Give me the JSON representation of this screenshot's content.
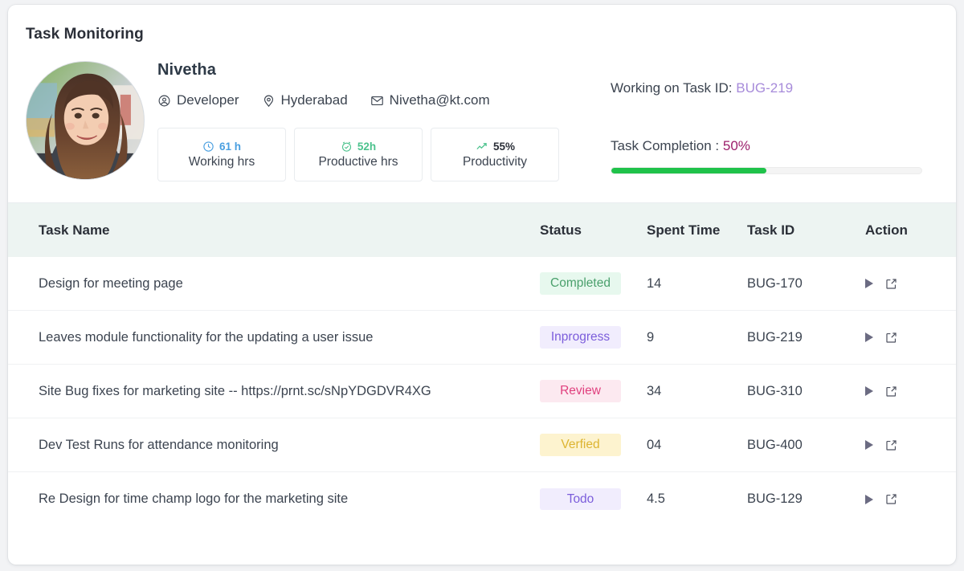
{
  "card": {
    "title": "Task Monitoring"
  },
  "profile": {
    "avatar_alt": "Nivetha profile photo",
    "name": "Nivetha",
    "meta": [
      {
        "icon": "user-circle-icon",
        "label": "Developer"
      },
      {
        "icon": "map-pin-icon",
        "label": "Hyderabad"
      },
      {
        "icon": "mail-icon",
        "label": "Nivetha@kt.com"
      }
    ],
    "stats": [
      {
        "icon": "clock-icon",
        "value": "61 h",
        "label": "Working hrs",
        "value_color": "#4a9fe0"
      },
      {
        "icon": "alarm-check-icon",
        "value": "52h",
        "label": "Productive hrs",
        "value_color": "#4cc28d"
      },
      {
        "icon": "trending-up-icon",
        "value": "55%",
        "label": "Productivity",
        "value_color": "#2b2f38"
      }
    ]
  },
  "task_summary": {
    "working_label": "Working on Task ID:",
    "working_task_id": "BUG-219",
    "working_task_id_color": "#a78bda",
    "completion_label": "Task Completion :",
    "completion_value": "50%",
    "completion_value_color": "#9c1f6b",
    "progress_percent": 50,
    "progress_color": "#1fc24a"
  },
  "table": {
    "columns": [
      {
        "key": "task_name",
        "label": "Task Name"
      },
      {
        "key": "status",
        "label": "Status"
      },
      {
        "key": "spent_time",
        "label": "Spent Time"
      },
      {
        "key": "task_id",
        "label": "Task ID"
      },
      {
        "key": "action",
        "label": "Action"
      }
    ],
    "rows": [
      {
        "task_name": "Design for meeting page",
        "status": "Completed",
        "status_class": "badge-completed",
        "spent_time": "14",
        "task_id": "BUG-170"
      },
      {
        "task_name": "Leaves module functionality for the updating a user issue",
        "status": "Inprogress",
        "status_class": "badge-inprogress",
        "spent_time": "9",
        "task_id": "BUG-219"
      },
      {
        "task_name": "Site Bug fixes for marketing site -- https://prnt.sc/sNpYDGDVR4XG",
        "status": "Review",
        "status_class": "badge-review",
        "spent_time": "34",
        "task_id": "BUG-310"
      },
      {
        "task_name": "Dev Test Runs for attendance monitoring",
        "status": "Verfied",
        "status_class": "badge-verfied",
        "spent_time": "04",
        "task_id": "BUG-400"
      },
      {
        "task_name": "Re Design for time champ logo for the marketing site",
        "status": "Todo",
        "status_class": "badge-todo",
        "spent_time": "4.5",
        "task_id": "BUG-129"
      }
    ],
    "row_actions": [
      {
        "icon": "play-icon",
        "name": "start-task-button"
      },
      {
        "icon": "external-link-icon",
        "name": "open-task-button"
      }
    ]
  }
}
